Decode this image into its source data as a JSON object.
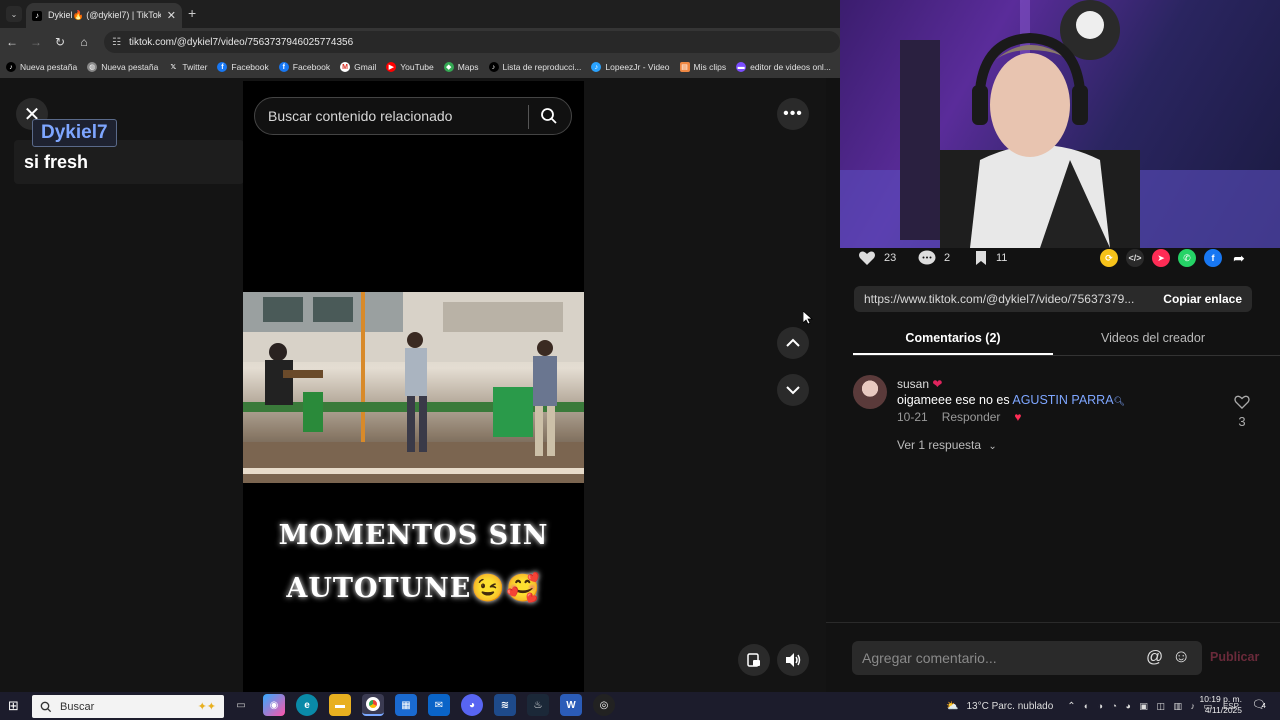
{
  "browser": {
    "tab_title": "Dykiel🔥 (@dykiel7) | TikTok",
    "tab_audio_icon": "speaker-icon",
    "address": "tiktok.com/@dykiel7/video/7563737946025774356",
    "bookmarks": [
      {
        "label": "Nueva pestaña",
        "icon": "tiktok-icon"
      },
      {
        "label": "Nueva pestaña",
        "icon": "globe-icon"
      },
      {
        "label": "Twitter",
        "icon": "x-icon"
      },
      {
        "label": "Facebook",
        "icon": "facebook-icon"
      },
      {
        "label": "Facebook",
        "icon": "facebook-icon"
      },
      {
        "label": "Gmail",
        "icon": "gmail-icon"
      },
      {
        "label": "YouTube",
        "icon": "youtube-icon"
      },
      {
        "label": "Maps",
        "icon": "maps-icon"
      },
      {
        "label": "Lista de reproducci...",
        "icon": "tiktok-icon"
      },
      {
        "label": "LopeezJr - Video",
        "icon": "tiktok-icon"
      },
      {
        "label": "Mis clips",
        "icon": "clips-icon"
      },
      {
        "label": "editor de videos onl...",
        "icon": "editor-icon"
      }
    ]
  },
  "video": {
    "channel_tag": "Dykiel7",
    "caption": "si fresh",
    "search_placeholder": "Buscar contenido relacionado",
    "overlay_line1": "MOMENTOS SIN",
    "overlay_line2": "AUTOTUNE😉🥰"
  },
  "stats": {
    "likes": "23",
    "comments": "2",
    "saves": "11"
  },
  "share": {
    "url": "https://www.tiktok.com/@dykiel7/video/75637379...",
    "copy_label": "Copiar enlace"
  },
  "tabs": {
    "comments": "Comentarios (2)",
    "creator_videos": "Videos del creador"
  },
  "comment": {
    "user": "susan",
    "user_heart": "❤",
    "text": "oigameee ese no es ",
    "mention": "AGUSTIN PARRA",
    "date": "10-21",
    "reply": "Responder",
    "like_count": "3",
    "view_replies": "Ver 1 respuesta"
  },
  "composer": {
    "placeholder": "Agregar comentario...",
    "publish": "Publicar"
  },
  "taskbar": {
    "search": "Buscar",
    "weather": "13°C  Parc. nublado",
    "lang": "ESP",
    "time": "10:19 p. m.",
    "date": "4/11/2025",
    "notifications": "4"
  },
  "colors": {
    "accent_blue": "#7ea6ff",
    "tiktok_red": "#fe2c55",
    "bg": "#121212"
  }
}
